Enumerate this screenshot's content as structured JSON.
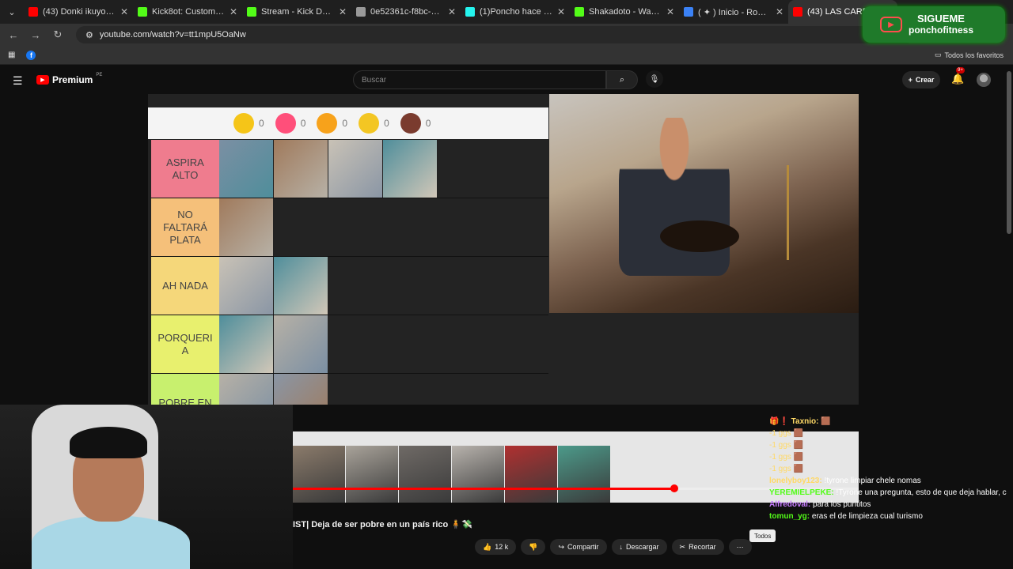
{
  "browser": {
    "tabs": [
      {
        "title": "(43) Donki ikuyo (Extende",
        "color": "#ff0000"
      },
      {
        "title": "Kick8ot: Customizable Ch",
        "color": "#53fc18"
      },
      {
        "title": "Stream - Kick Dashboard",
        "color": "#53fc18"
      },
      {
        "title": "0e52361c-f8bc-485b-bca",
        "color": "#999999"
      },
      {
        "title": "(1)Poncho hace torneos d",
        "color": "#25f4ee"
      },
      {
        "title": "Shakadoto - Watch clips",
        "color": "#53fc18"
      },
      {
        "title": "( ✦ ) Inicio - Roblox",
        "color": "#3b82f6"
      },
      {
        "title": "(43) LAS CARRERAS M",
        "color": "#ff0000"
      }
    ],
    "url": "youtube.com/watch?v=tt1mpU5OaNw",
    "all_bookmarks_label": "Todos los favoritos"
  },
  "promo": {
    "line1": "SIGUEME",
    "line2": "ponchofitness"
  },
  "youtube": {
    "logo": "Premium",
    "logo_sup": "PE",
    "search_placeholder": "Buscar",
    "create_label": "Crear",
    "notif_count": "9+"
  },
  "video": {
    "reactions": [
      {
        "count": "0",
        "color": "#f5c518"
      },
      {
        "count": "0",
        "color": "#ff4f7a"
      },
      {
        "count": "0",
        "color": "#f7a21b"
      },
      {
        "count": "0",
        "color": "#f3c623"
      },
      {
        "count": "0",
        "color": "#7a3b2e"
      }
    ],
    "tiers": [
      {
        "label": "ASPIRA ALTO",
        "color": "#ef7c8e",
        "tiles": 4
      },
      {
        "label": "NO\nFALTARÁ\nPLATA",
        "color": "#f5c07a",
        "tiles": 1
      },
      {
        "label": "AH NADA",
        "color": "#f5d77a",
        "tiles": 2
      },
      {
        "label": "PORQUERI\nA",
        "color": "#e8f06e",
        "tiles": 2
      },
      {
        "label": "POBRE EN",
        "color": "#c8f06e",
        "tiles": 2
      }
    ],
    "progress_percent": 67.8,
    "title": "IST| Deja de ser pobre en un país rico 🧍💸",
    "likes": "12 k",
    "share_label": "Compartir",
    "download_label": "Descargar",
    "clip_label": "Recortar"
  },
  "chat": [
    {
      "user": "🎁❗ Taxnio:",
      "msg": "🟫",
      "color": "#ffd966"
    },
    {
      "user": "",
      "msg": "-1 ggs 🟫",
      "color": "#ffd966"
    },
    {
      "user": "",
      "msg": "-1 ggs 🟫",
      "color": "#ffd966"
    },
    {
      "user": "",
      "msg": "-1 ggs 🟫",
      "color": "#ffd966"
    },
    {
      "user": "",
      "msg": "-1 ggs 🟫",
      "color": "#ffd966"
    },
    {
      "user": "lonelyboy123:",
      "msg": "!tyrone limpiar chele nomas",
      "color": "#ffd966"
    },
    {
      "user": "YEREMIELPEKE:",
      "msg": "!Tyrone una pregunta, esto de que deja hablar, como es? osea como se si alguien tiene activado para poder escribir lo del tyrone jajaja",
      "color": "#53fc18"
    },
    {
      "user": "Alfredoval:",
      "msg": "para los puntitos",
      "color": "#c77dff"
    },
    {
      "user": "tomun_yg:",
      "msg": "eras el de limpieza cual turismo",
      "color": "#53fc18"
    }
  ],
  "todos_label": "Todos"
}
